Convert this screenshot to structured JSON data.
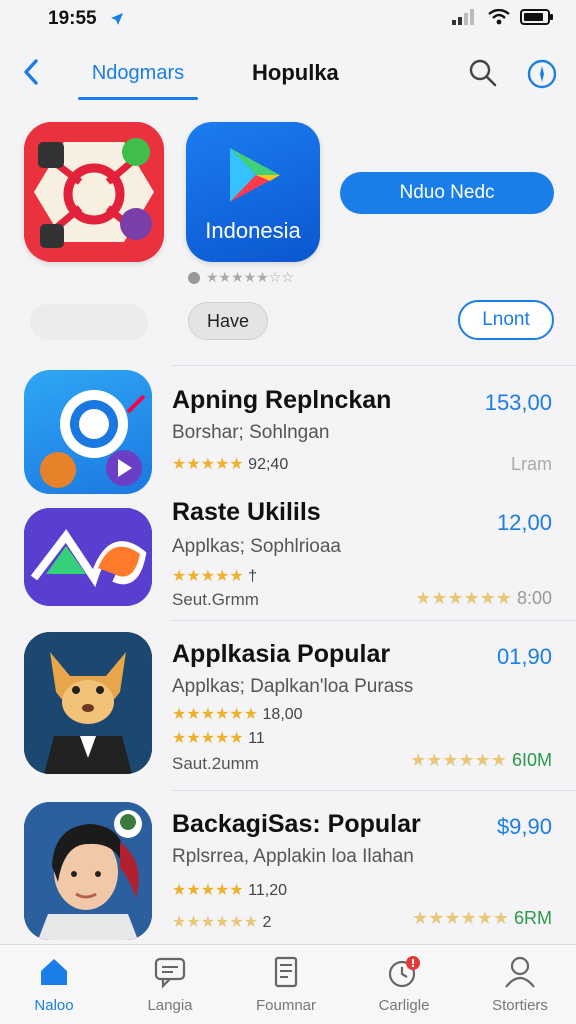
{
  "status": {
    "time": "19:55"
  },
  "nav": {
    "tab_label": "Ndogmars",
    "title": "Hopulka"
  },
  "featured": {
    "play_label": "Indonesia",
    "primary_button": "Nduo Nedc",
    "rating_stars": "★★★★★☆☆",
    "gray_button": "Have",
    "outline_button": "Lnont"
  },
  "apps": [
    {
      "title": "Apning Replnckan",
      "subtitle": "Borshar; Sohlngan",
      "stars": "★★★★★",
      "rating_text": "92;40",
      "price": "153,00",
      "right_meta": "Lram"
    },
    {
      "title": "Raste Ukilils",
      "subtitle": "Applkas; Sophlrioaa",
      "stars": "★★★★★",
      "rating_text": "†",
      "size": "Seut.Grmm",
      "price": "12,00",
      "right_stars": "★★★★★★",
      "right_meta": "8:00"
    },
    {
      "title": "Applkasia Popular",
      "subtitle": "Applkas; Daplkan'loa Purass",
      "stars": "★★★★★★",
      "rating_text": "18,00",
      "stars2": "★★★★★",
      "rating_text2": "11",
      "size": "Saut.2umm",
      "price": "01,90",
      "right_stars": "★★★★★★",
      "right_meta": "6I0M"
    },
    {
      "title": "BackagiSas: Popular",
      "subtitle": "Rplsrrea, Applakin loa Ilahan",
      "stars": "★★★★★",
      "rating_text": "11,20",
      "stars2": "★★★★★★",
      "rating_text2": "2",
      "price": "$9,90",
      "right_stars": "★★★★★★",
      "right_meta": "6RM"
    }
  ],
  "tabs": [
    {
      "label": "Naloo",
      "icon": "home-icon"
    },
    {
      "label": "Langia",
      "icon": "chat-icon"
    },
    {
      "label": "Foumnar",
      "icon": "document-icon"
    },
    {
      "label": "Carligle",
      "icon": "clock-badge-icon"
    },
    {
      "label": "Stortiers",
      "icon": "person-icon"
    }
  ],
  "colors": {
    "accent": "#1a7ee8",
    "star": "#f0b12a"
  }
}
